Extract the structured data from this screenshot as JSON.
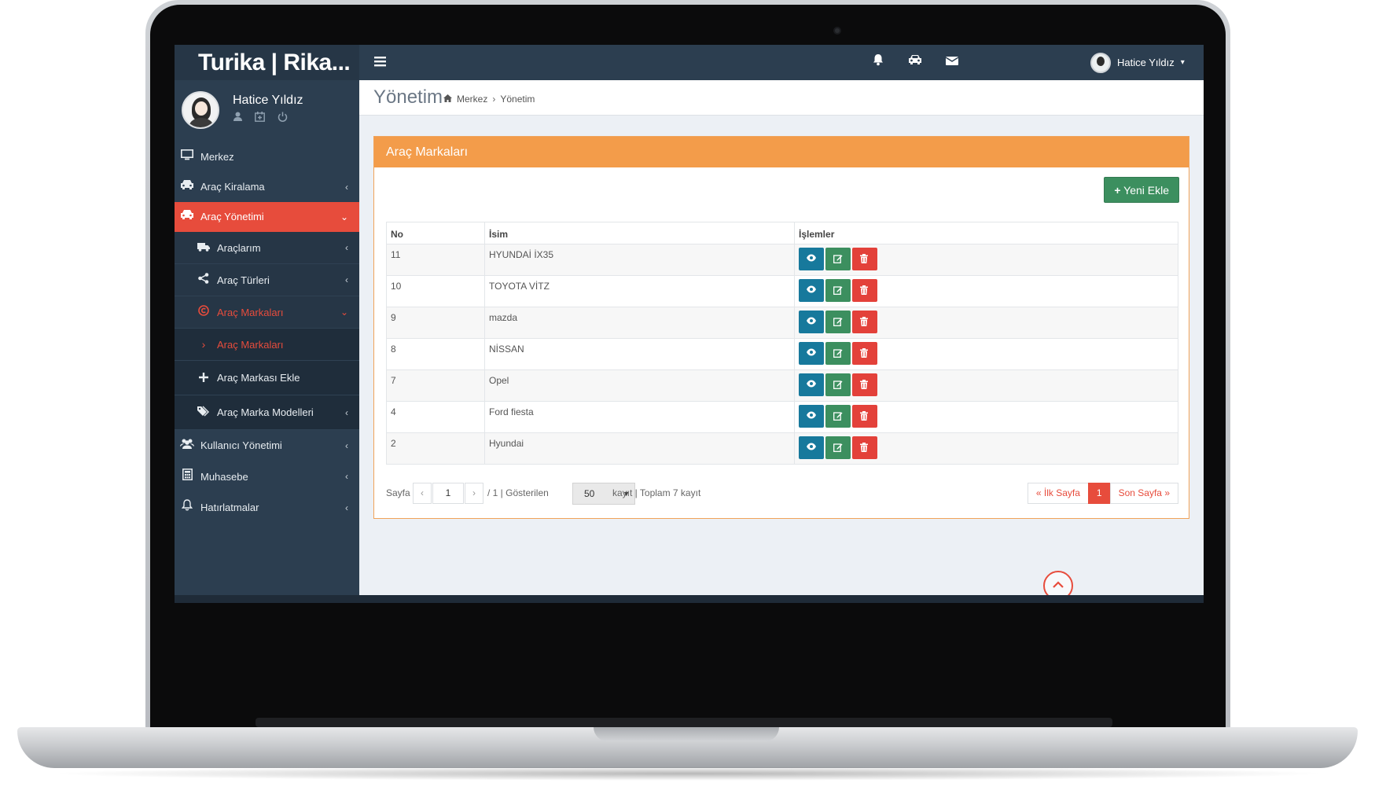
{
  "app": {
    "logo": "Turika | Rika..."
  },
  "topbar": {
    "menu_icon": "bars-icon",
    "icons": [
      "bell-icon",
      "car-icon",
      "envelope-icon"
    ],
    "user_name": "Hatice Yıldız",
    "user_caret": "▾"
  },
  "sidebar": {
    "user_name": "Hatice Yıldız",
    "user_tools": [
      "user-icon",
      "calendar-icon",
      "power-icon"
    ],
    "items": [
      {
        "label": "Merkez",
        "icon": "desktop-icon"
      },
      {
        "label": "Araç Kiralama",
        "icon": "taxi-icon"
      },
      {
        "label": "Araç Yönetimi",
        "icon": "car-icon",
        "active": true
      },
      {
        "label": "Kullanıcı Yönetimi",
        "icon": "users-icon"
      },
      {
        "label": "Muhasebe",
        "icon": "calculator-icon"
      },
      {
        "label": "Hatırlatmalar",
        "icon": "bell-icon"
      }
    ],
    "submenu": [
      {
        "label": "Araçlarım",
        "icon": "truck-icon"
      },
      {
        "label": "Araç Türleri",
        "icon": "share-icon"
      },
      {
        "label": "Araç Markaları",
        "icon": "copyright-icon",
        "open": true
      },
      {
        "label": "Araç Markaları",
        "icon": "chevron-right-icon",
        "selected": true
      },
      {
        "label": "Araç Markası Ekle",
        "icon": "plus-icon"
      },
      {
        "label": "Araç Marka Modelleri",
        "icon": "tags-icon"
      }
    ]
  },
  "header": {
    "title": "Yönetim",
    "breadcrumb": [
      "Merkez",
      "Yönetim"
    ]
  },
  "panel": {
    "title": "Araç Markaları",
    "new_button": "Yeni Ekle",
    "columns": [
      "No",
      "İsim",
      "İşlemler"
    ],
    "rows": [
      {
        "no": "11",
        "name": "HYUNDAİ İX35"
      },
      {
        "no": "10",
        "name": "TOYOTA VİTZ"
      },
      {
        "no": "9",
        "name": "mazda"
      },
      {
        "no": "8",
        "name": "NİSSAN"
      },
      {
        "no": "7",
        "name": "Opel"
      },
      {
        "no": "4",
        "name": "Ford fiesta"
      },
      {
        "no": "2",
        "name": "Hyundai"
      }
    ],
    "actions": [
      "eye-icon",
      "edit-icon",
      "trash-icon"
    ]
  },
  "pager": {
    "page_label": "Sayfa",
    "prev": "‹",
    "page": "1",
    "next": "›",
    "of_pages": "/ 1 | Gösterilen",
    "per_page": "50",
    "summary": "kayıt | Toplam 7 kayıt",
    "first": "« İlk Sayfa",
    "current": "1",
    "last": "Son Sayfa »"
  },
  "colors": {
    "sidebar": "#2c3e50",
    "active": "#e74c3c",
    "panel_heading": "#f39c4a",
    "view_button": "#17799c",
    "edit_button": "#3c8f5f",
    "delete_button": "#e3413a"
  }
}
